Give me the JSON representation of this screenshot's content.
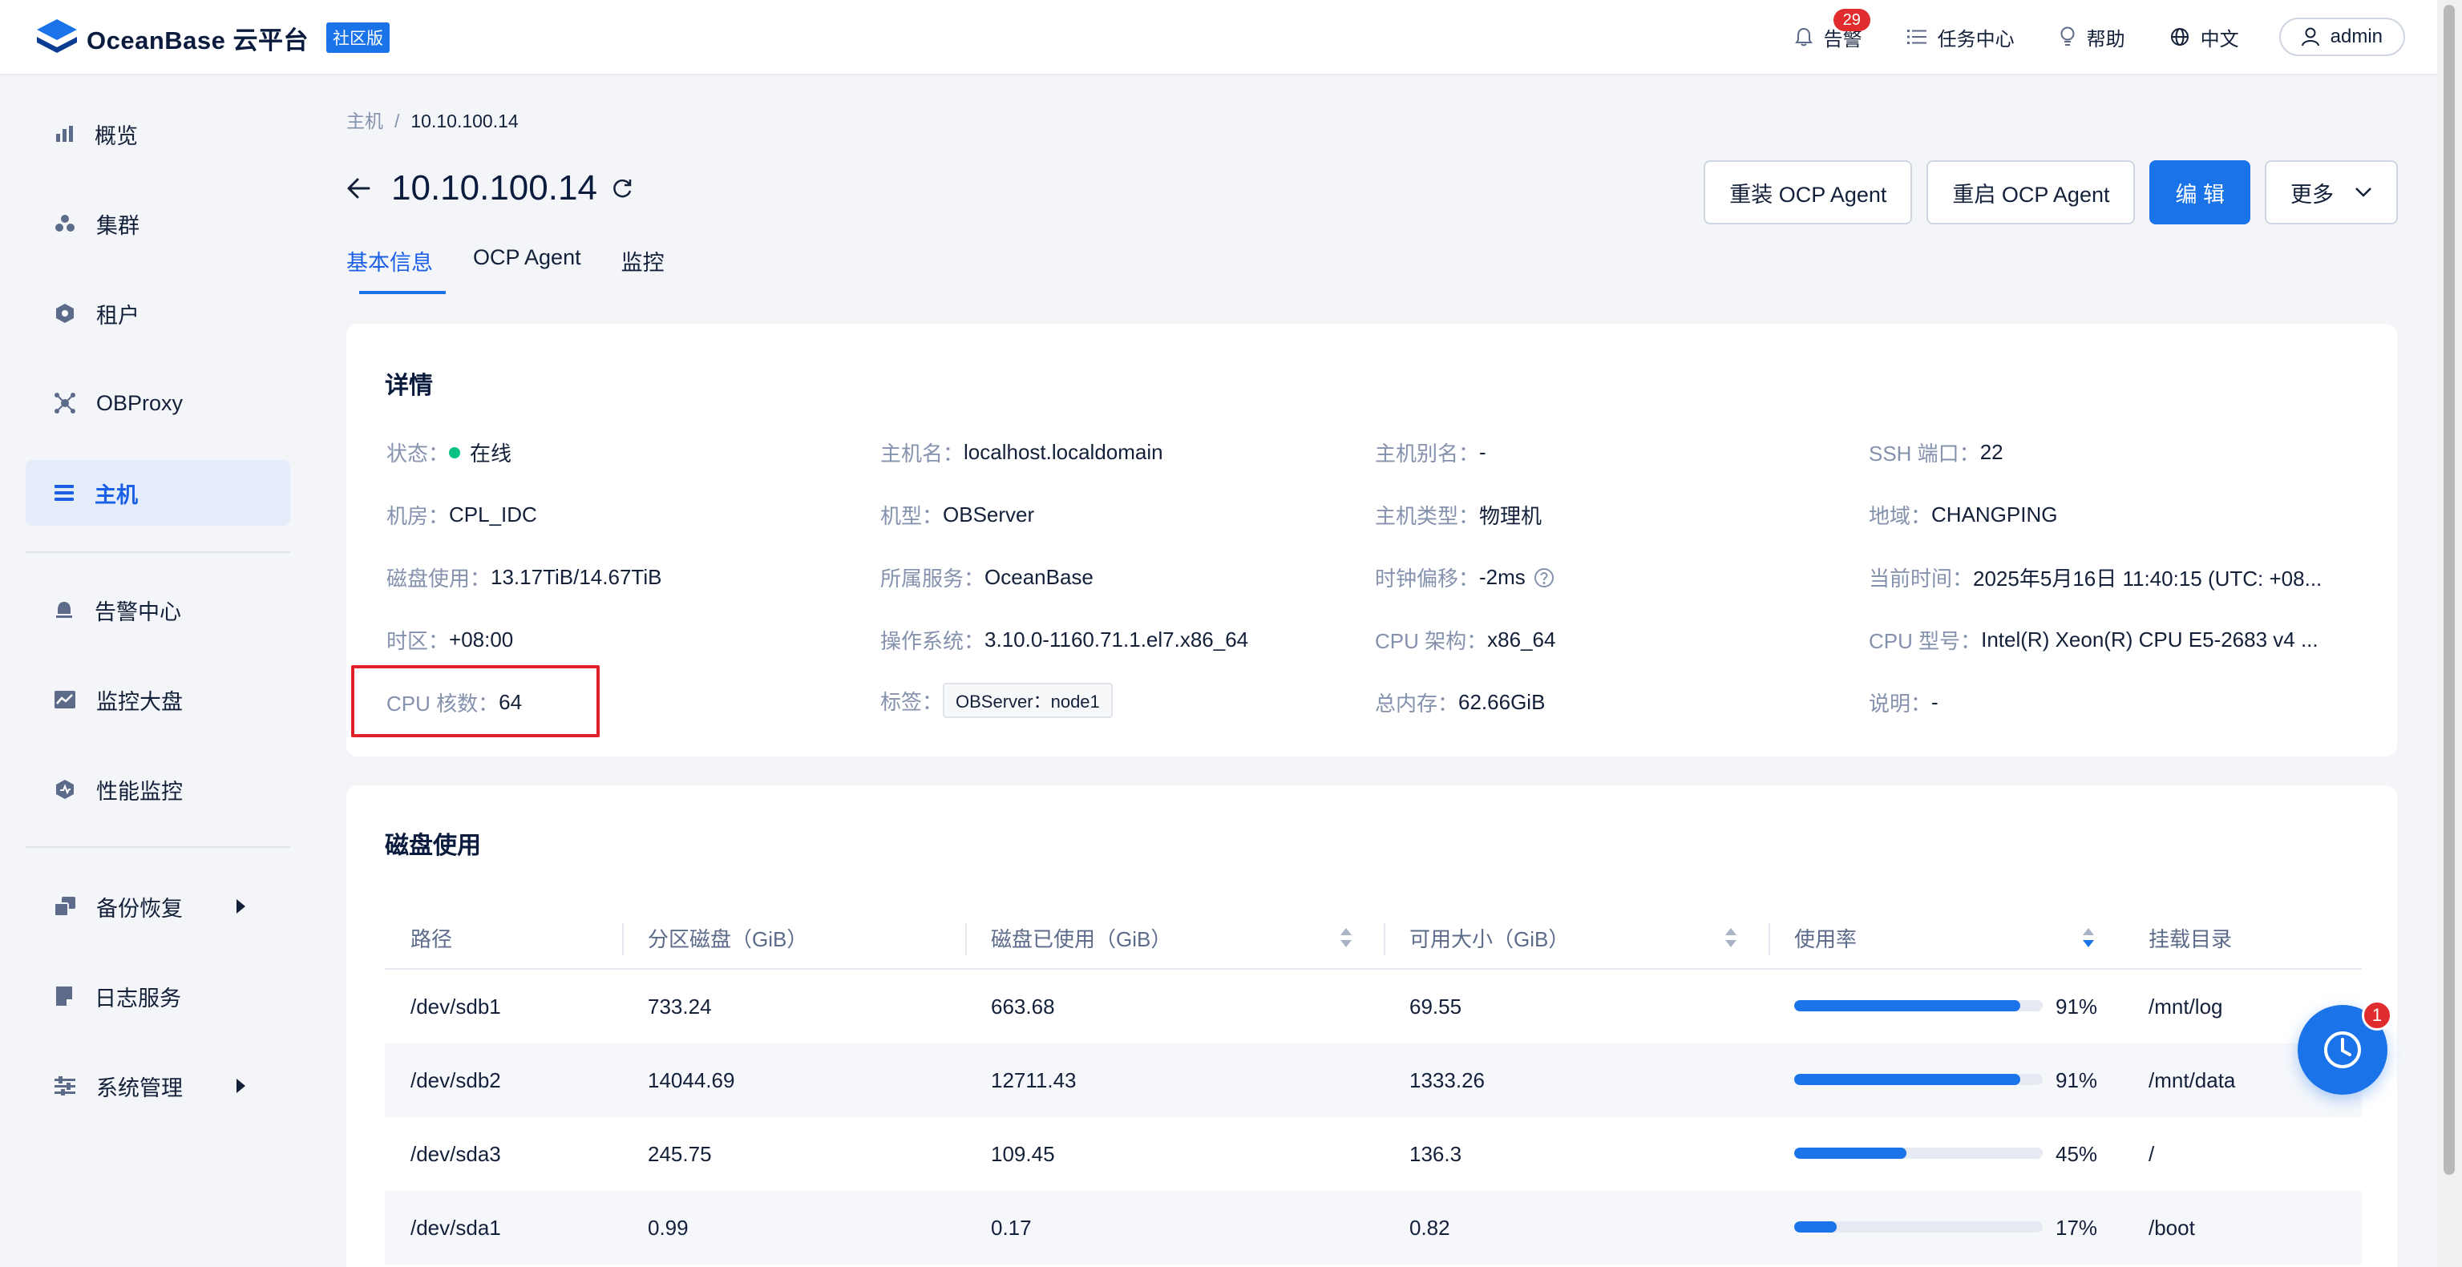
{
  "header": {
    "brand": "OceanBase 云平台",
    "edition_badge": "社区版",
    "alerts_label": "告警",
    "alerts_count": "29",
    "tasks_label": "任务中心",
    "help_label": "帮助",
    "language_label": "中文",
    "user_label": "admin"
  },
  "sidebar": {
    "items": [
      {
        "label": "概览",
        "icon": "bar-chart-icon"
      },
      {
        "label": "集群",
        "icon": "cluster-icon"
      },
      {
        "label": "租户",
        "icon": "tenant-icon"
      },
      {
        "label": "OBProxy",
        "icon": "proxy-icon"
      },
      {
        "label": "主机",
        "icon": "host-list-icon",
        "active": true
      },
      {
        "label": "告警中心",
        "icon": "alarm-icon"
      },
      {
        "label": "监控大盘",
        "icon": "dashboard-icon"
      },
      {
        "label": "性能监控",
        "icon": "performance-icon"
      },
      {
        "label": "备份恢复",
        "icon": "backup-icon",
        "expandable": true
      },
      {
        "label": "日志服务",
        "icon": "log-icon"
      },
      {
        "label": "系统管理",
        "icon": "settings-icon",
        "expandable": true
      }
    ]
  },
  "breadcrumb": {
    "parent": "主机",
    "separator": "/",
    "current": "10.10.100.14"
  },
  "page": {
    "title": "10.10.100.14"
  },
  "actions": {
    "reinstall": "重装 OCP Agent",
    "restart": "重启 OCP Agent",
    "edit": "编 辑",
    "more": "更多"
  },
  "tabs": [
    "基本信息",
    "OCP Agent",
    "监控"
  ],
  "details": {
    "title": "详情",
    "fields": [
      {
        "key": "状态：",
        "value": "在线"
      },
      {
        "key": "主机名：",
        "value": "localhost.localdomain"
      },
      {
        "key": "主机别名：",
        "value": "-"
      },
      {
        "key": "SSH 端口：",
        "value": "22"
      },
      {
        "key": "机房：",
        "value": "CPL_IDC"
      },
      {
        "key": "机型：",
        "value": "OBServer"
      },
      {
        "key": "主机类型：",
        "value": "物理机"
      },
      {
        "key": "地域：",
        "value": "CHANGPING"
      },
      {
        "key": "磁盘使用：",
        "value": "13.17TiB/14.67TiB"
      },
      {
        "key": "所属服务：",
        "value": "OceanBase"
      },
      {
        "key": "时钟偏移：",
        "value": "-2ms"
      },
      {
        "key": "当前时间：",
        "value": "2025年5月16日 11:40:15 (UTC: +08..."
      },
      {
        "key": "时区：",
        "value": "+08:00"
      },
      {
        "key": "操作系统：",
        "value": "3.10.0-1160.71.1.el7.x86_64"
      },
      {
        "key": "CPU 架构：",
        "value": "x86_64"
      },
      {
        "key": "CPU 型号：",
        "value": "Intel(R) Xeon(R) CPU E5-2683 v4 ..."
      },
      {
        "key": "CPU 核数：",
        "value": "64"
      },
      {
        "key": "标签：",
        "value": "OBServer：node1"
      },
      {
        "key": "总内存：",
        "value": "62.66GiB"
      },
      {
        "key": "说明：",
        "value": "-"
      }
    ]
  },
  "disk": {
    "title": "磁盘使用",
    "columns": [
      "路径",
      "分区磁盘（GiB）",
      "磁盘已使用（GiB）",
      "可用大小（GiB）",
      "使用率",
      "挂载目录"
    ],
    "rows": [
      {
        "path": "/dev/sdb1",
        "size": "733.24",
        "used": "663.68",
        "avail": "69.55",
        "usage_pct": 91,
        "usage": "91%",
        "mount": "/mnt/log"
      },
      {
        "path": "/dev/sdb2",
        "size": "14044.69",
        "used": "12711.43",
        "avail": "1333.26",
        "usage_pct": 91,
        "usage": "91%",
        "mount": "/mnt/data"
      },
      {
        "path": "/dev/sda3",
        "size": "245.75",
        "used": "109.45",
        "avail": "136.3",
        "usage_pct": 45,
        "usage": "45%",
        "mount": "/"
      },
      {
        "path": "/dev/sda1",
        "size": "0.99",
        "used": "0.17",
        "avail": "0.82",
        "usage_pct": 17,
        "usage": "17%",
        "mount": "/boot"
      }
    ]
  },
  "float_button": {
    "badge": "1",
    "icon": "clock-icon"
  },
  "colors": {
    "primary": "#1a73e8",
    "online": "#0ac185",
    "alert": "#e02c2c",
    "highlight": "#e0202a"
  }
}
